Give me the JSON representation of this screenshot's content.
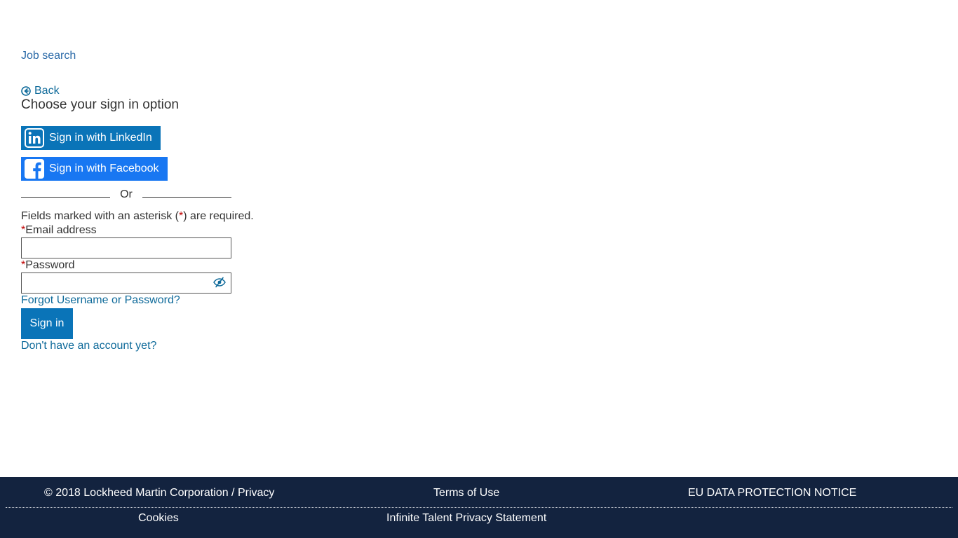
{
  "header": {
    "job_search_link": "Job search"
  },
  "signin": {
    "back_label": "Back",
    "title": "Choose your sign in option",
    "linkedin_label": "Sign in with LinkedIn",
    "facebook_label": "Sign in with Facebook",
    "or_text": "Or",
    "required_note_before": "Fields marked with an asterisk (",
    "required_asterisk": "*",
    "required_note_after": ") are required.",
    "email_label": "Email address",
    "email_value": "",
    "password_label": "Password",
    "password_value": "",
    "forgot_link": "Forgot Username or Password?",
    "sign_in_button": "Sign in",
    "no_account_link": "Don't have an account yet?"
  },
  "icons": {
    "back": "arrow-circle-left-icon",
    "linkedin": "linkedin-icon",
    "facebook": "facebook-icon",
    "password_toggle": "eye-slash-icon"
  },
  "colors": {
    "link": "#0e6a9a",
    "primary_button": "#0a74b8",
    "facebook": "#1877f2",
    "footer_bg": "#13233f",
    "required": "#c00000"
  },
  "footer": {
    "copyright_privacy": "© 2018 Lockheed Martin Corporation / Privacy",
    "terms": "Terms of Use",
    "eu_notice": "EU DATA PROTECTION NOTICE",
    "cookies": "Cookies",
    "infinite_talent": "Infinite Talent Privacy Statement"
  }
}
